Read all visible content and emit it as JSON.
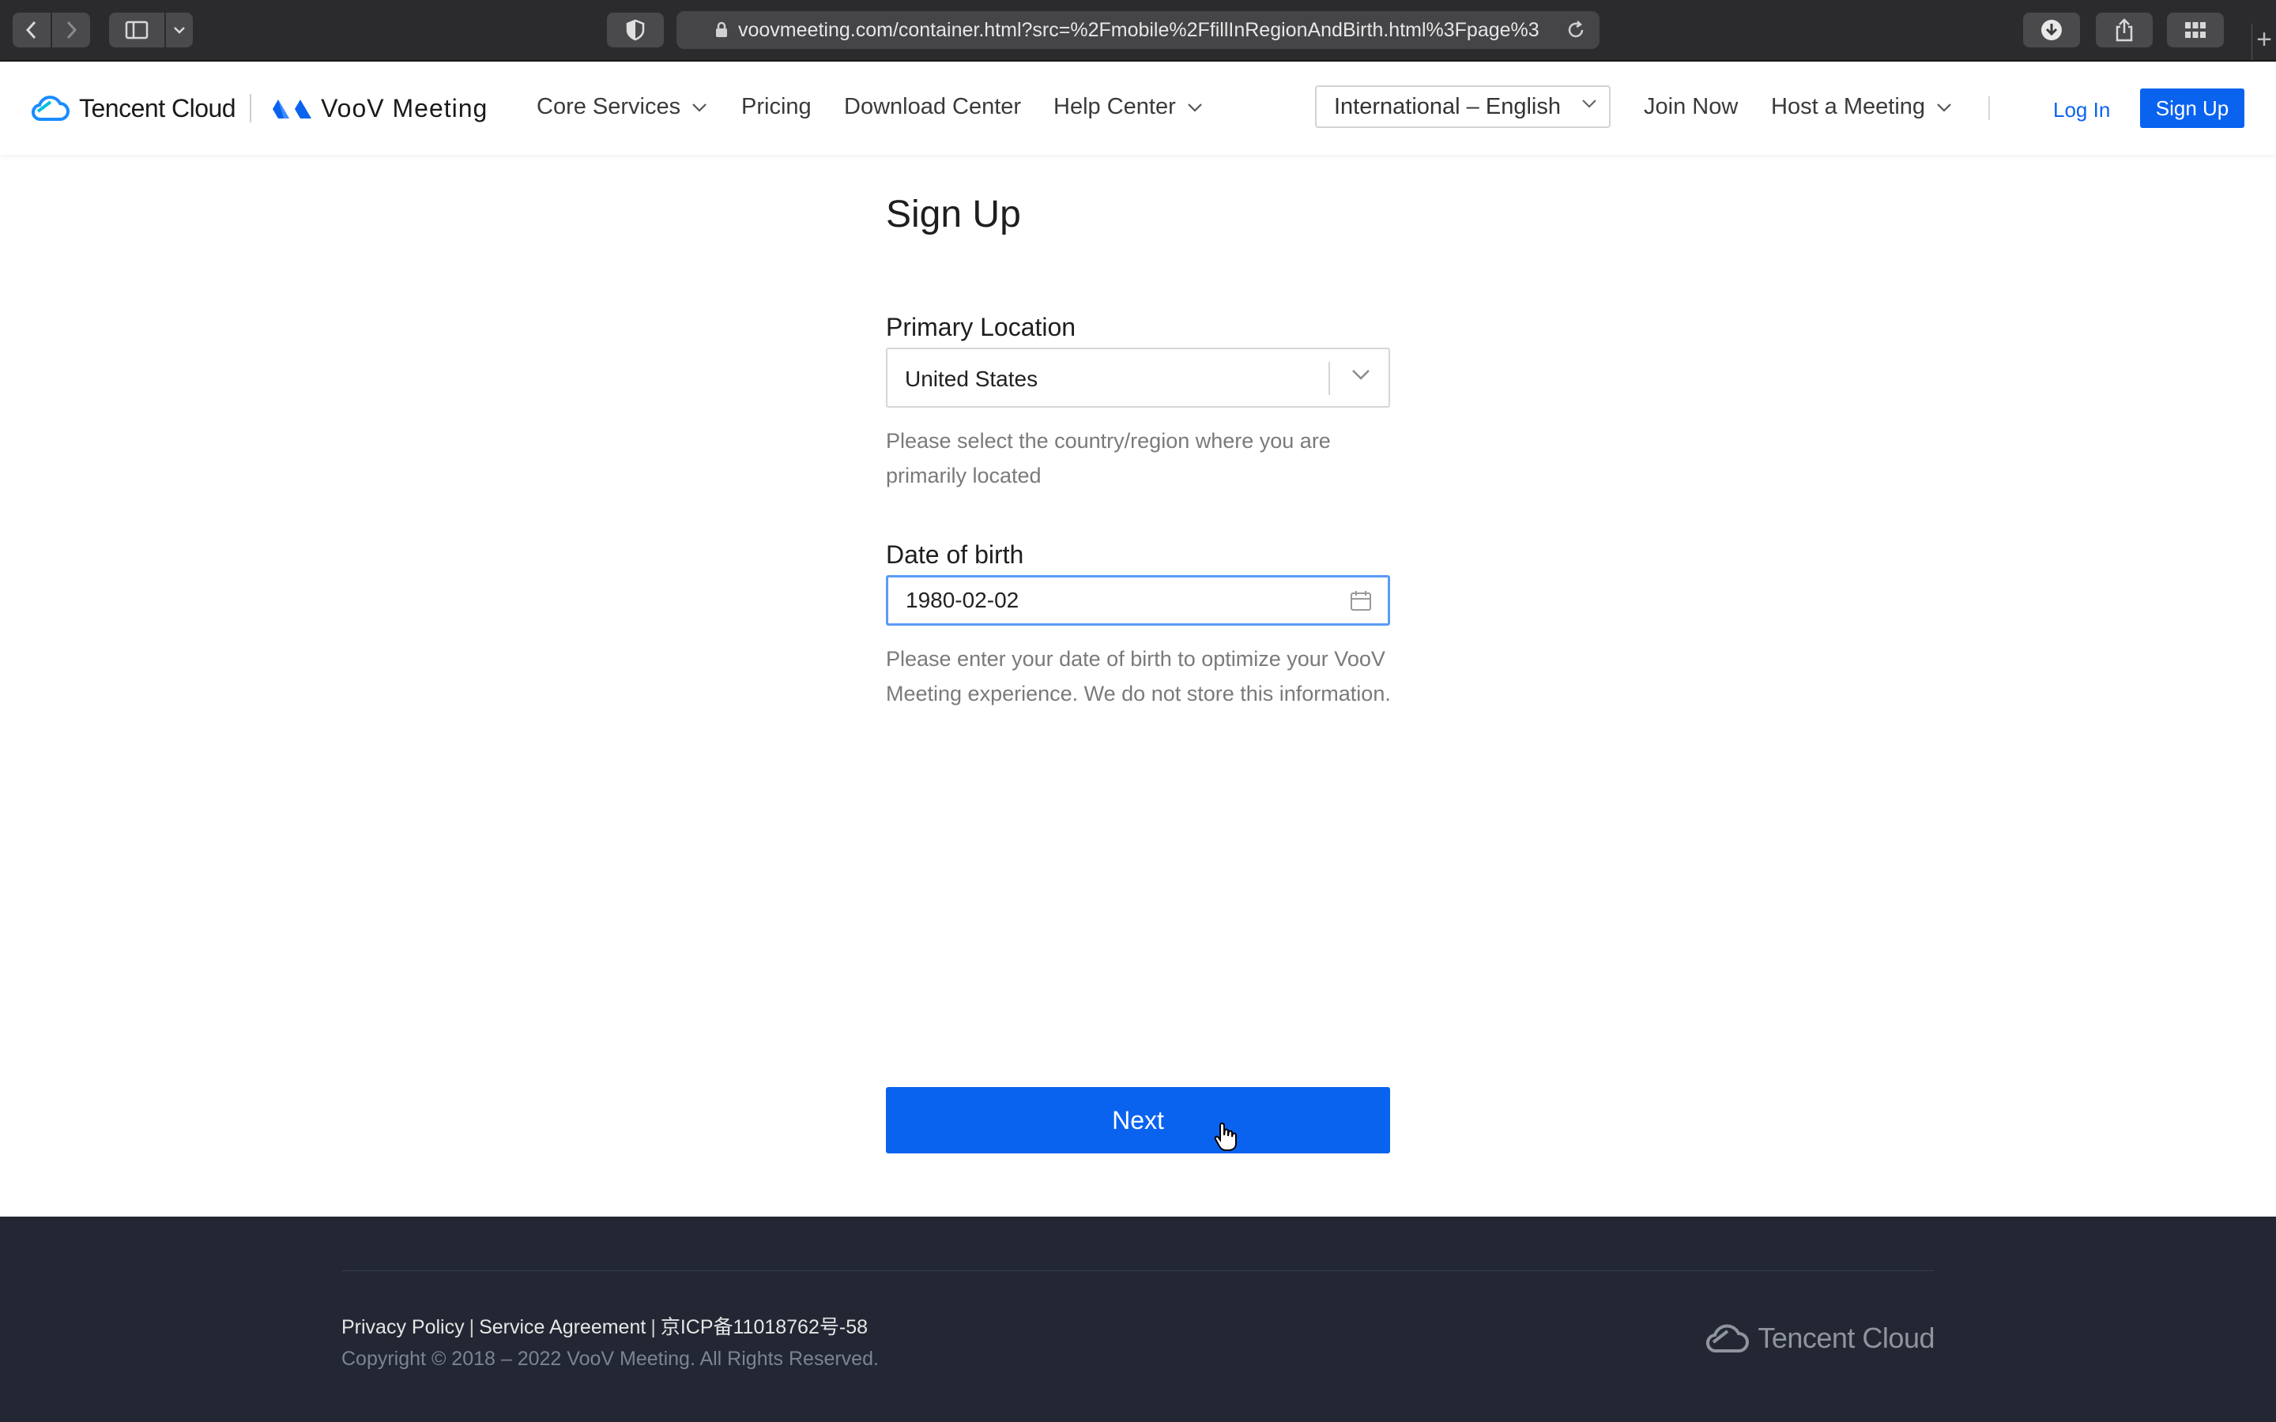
{
  "browser": {
    "url": "voovmeeting.com/container.html?src=%2Fmobile%2FfillInRegionAndBirth.html%3Fpage%3"
  },
  "header": {
    "brand_tencent": "Tencent Cloud",
    "brand_voov": "VooV Meeting",
    "nav": {
      "core_services": "Core Services",
      "pricing": "Pricing",
      "download_center": "Download Center",
      "help_center": "Help Center"
    },
    "language": "International – English",
    "join_now": "Join Now",
    "host_meeting": "Host a Meeting",
    "log_in": "Log In",
    "sign_up": "Sign Up"
  },
  "form": {
    "title": "Sign Up",
    "location_label": "Primary Location",
    "location_value": "United States",
    "location_hint": "Please select the country/region where you are primarily located",
    "dob_label": "Date of birth",
    "dob_value": "1980-02-02",
    "dob_hint": "Please enter your date of birth to optimize your VooV Meeting experience. We do not store this information.",
    "next_label": "Next"
  },
  "footer": {
    "privacy": "Privacy Policy",
    "service": "Service Agreement",
    "icp": "京ICP备11018762号-58",
    "separator": "|",
    "copyright": "Copyright © 2018 – 2022 VooV Meeting. All Rights Reserved.",
    "brand": "Tencent Cloud"
  },
  "colors": {
    "accent": "#0a63ef",
    "footer_bg": "#222733",
    "focus_border": "#5b9bf5"
  }
}
